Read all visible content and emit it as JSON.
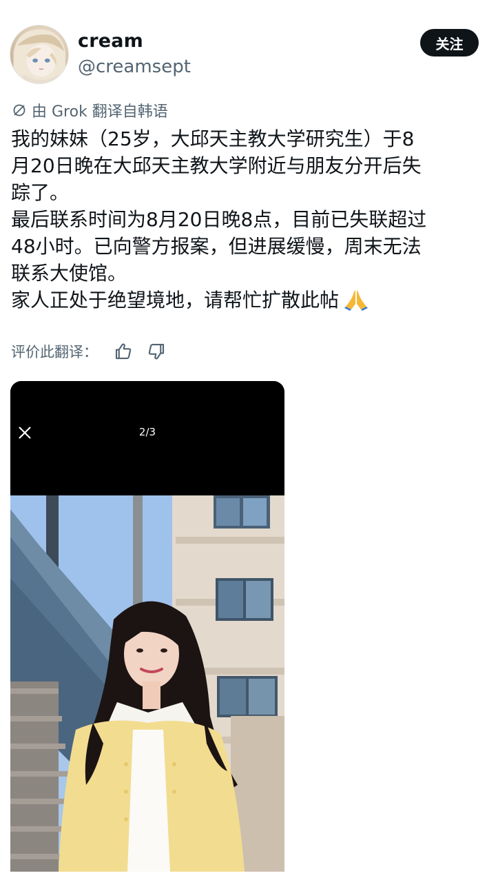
{
  "header": {
    "display_name": "cream",
    "handle": "@creamsept",
    "follow_label": "关注"
  },
  "translation": {
    "label": "由 Grok 翻译自韩语"
  },
  "post": {
    "lines": [
      "我的妹妹（25岁，大邱天主教大学研究生）于8",
      "月20日晚在大邱天主教大学附近与朋友分开后失",
      "踪了。",
      "最后联系时间为8月20日晚8点，目前已失联超过",
      "48小时。已向警方报案，但进展缓慢，周末无法",
      "联系大使馆。",
      "家人正处于绝望境地，请帮忙扩散此帖"
    ],
    "emoji": "pray-icon"
  },
  "rate": {
    "label": "评价此翻译："
  },
  "media": {
    "counter": "2/3"
  },
  "icons": {
    "close": "close-icon",
    "thumbs_up": "thumbs-up-icon",
    "thumbs_down": "thumbs-down-icon",
    "translate": "translate-icon"
  },
  "colors": {
    "text": "#0f1419",
    "secondary": "#536471",
    "button_bg": "#0f1419"
  }
}
